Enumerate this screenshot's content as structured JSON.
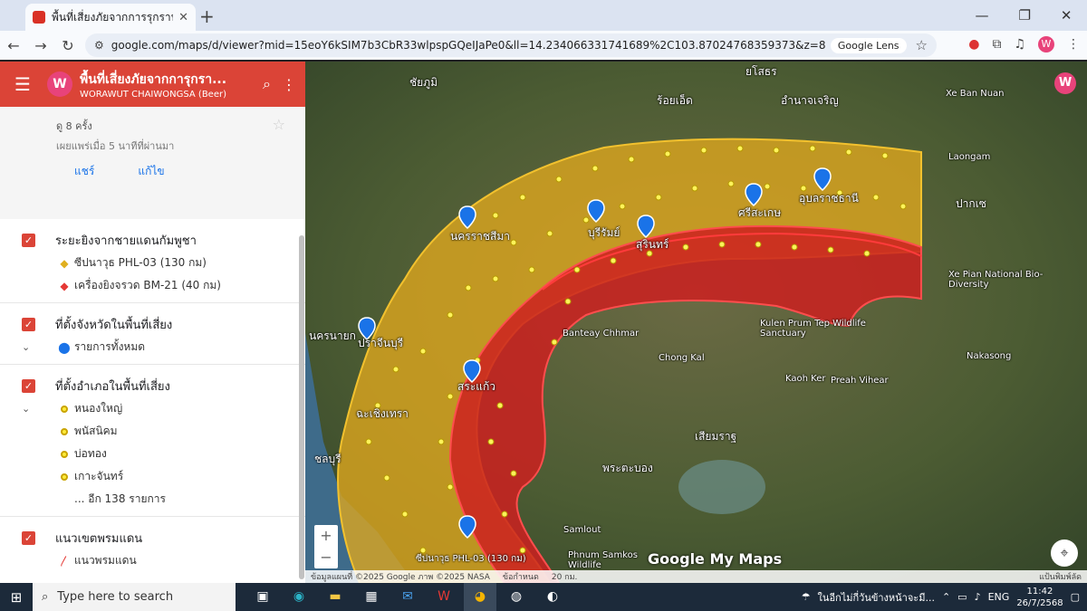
{
  "browser": {
    "tab_title": "พื้นที่เสี่ยงภัยจากการรุกรานของกัมพูชา",
    "url": "google.com/maps/d/viewer?mid=15eoY6kSIM7b3CbR33wlpspGQeIJaPe0&ll=14.234066331741689%2C103.87024768359373&z=8",
    "lens_label": "Google Lens",
    "profile_initial": "W"
  },
  "sidebar": {
    "title": "พื้นที่เสี่ยงภัยจากการุกรา...",
    "author": "WORAWUT CHAIWONGSA (Beer)",
    "avatar": "W",
    "views": "ดู 8 ครั้ง",
    "published": "เผยแพร่เมื่อ 5 นาทีที่ผ่านมา",
    "share": "แชร์",
    "edit": "แก้ไข",
    "layers": [
      {
        "name": "ระยะยิงจากชายแดนกัมพูชา",
        "items": [
          "ซีปนาวุธ PHL-03 (130 กม)",
          "เครื่องยิงจรวด BM-21 (40 กม)"
        ]
      },
      {
        "name": "ที่ตั้งจังหวัดในพื้นที่เสี่ยง",
        "items": [
          "รายการทั้งหมด"
        ]
      },
      {
        "name": "ที่ตั้งอำเภอในพื้นที่เสี่ยง",
        "items": [
          "หนองใหญ่",
          "พนัสนิคม",
          "บ่อทอง",
          "เกาะจันทร์",
          "... อีก 138 รายการ"
        ]
      },
      {
        "name": "แนวเขตพรมแดน",
        "items": [
          "แนวพรมแดน"
        ]
      }
    ]
  },
  "map": {
    "labels": [
      {
        "text": "ยโสธร"
      },
      {
        "text": "ร้อยเอ็ด"
      },
      {
        "text": "อำนาจเจริญ"
      },
      {
        "text": "ชัยภูมิ"
      },
      {
        "text": "นครราชสีมา"
      },
      {
        "text": "บุรีรัมย์"
      },
      {
        "text": "สุรินทร์"
      },
      {
        "text": "ศรีสะเกษ"
      },
      {
        "text": "อุบลราชธานี"
      },
      {
        "text": "ปราจีนบุรี"
      },
      {
        "text": "สระแก้ว"
      },
      {
        "text": "ฉะเชิงเทรา"
      },
      {
        "text": "ชลบุรี"
      },
      {
        "text": "นครนายก"
      },
      {
        "text": "Xe Pian National Bio-Diversity"
      },
      {
        "text": "Kulen Prum Tep Wildlife Sanctuary"
      },
      {
        "text": "เสียมราฐ"
      },
      {
        "text": "พระตะบอง"
      },
      {
        "text": "Samlout"
      },
      {
        "text": "Phnum Samkos Wildlife"
      },
      {
        "text": "Banteay Chhmar"
      },
      {
        "text": "Chong Kal"
      },
      {
        "text": "Kaoh Ker"
      },
      {
        "text": "Preah Vihear"
      },
      {
        "text": "Nakasong"
      },
      {
        "text": "Laongam"
      },
      {
        "text": "ปากเซ"
      },
      {
        "text": "Xe Ban Nuan"
      },
      {
        "text": "ซีปนาวุธ PHL-03 (130 กม)"
      }
    ],
    "attribution": "ข้อมูลแผนที่ ©2025 Google ภาพ ©2025 NASA",
    "terms": "ข้อกำหนด",
    "scale": "20 กม.",
    "shortcut": "แป้นพิมพ์ลัด",
    "watermark": "Google My Maps",
    "zoom_in": "+",
    "zoom_out": "−"
  },
  "taskbar": {
    "search_placeholder": "Type here to search",
    "weather": "ในอีกไม่กี่วันข้างหน้าจะมี...",
    "lang": "ENG",
    "time": "11:42",
    "date": "26/7/2568"
  }
}
